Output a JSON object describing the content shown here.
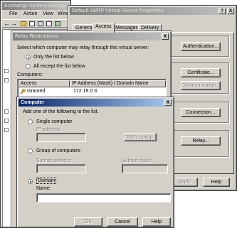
{
  "mmc": {
    "title": "Exchange System Manage",
    "menu": [
      "File",
      "Action",
      "View",
      "Wind"
    ]
  },
  "smtp": {
    "title": "Default SMTP Virtual Server Properties",
    "help_btn": "?",
    "close_btn": "X",
    "tabs": [
      "General",
      "Access",
      "Messages",
      "Delivery"
    ],
    "buttons": {
      "authentication": "Authentication...",
      "certificate": "Certificate...",
      "communication": "Communication...",
      "connection": "Connection...",
      "relay": "Relay...",
      "apply": "Apply",
      "help": "Help"
    }
  },
  "relay": {
    "title": "Relay Restrictions",
    "close_btn": "X",
    "prompt": "Select which computer may relay through this virtual server:",
    "radio_only": "Only the list below",
    "radio_all_except": "All except the list below",
    "computers_label": "Computers:",
    "col_access": "Access",
    "col_ip": "IP Address (Mask) / Domain Name",
    "rows": [
      {
        "access": "Granted",
        "ip": "172.16.0.3"
      }
    ]
  },
  "computer": {
    "title": "Computer",
    "close_btn": "X",
    "prompt": "Add one of the following to the list.",
    "single_label": "Single computer",
    "ip_label": "IP address:",
    "dns_btn": "DNS Lookup...",
    "group_label": "Group of computers",
    "subnet_addr_label": "Subnet address:",
    "subnet_mask_label": "Subnet mask:",
    "domain_label": "Domain",
    "name_label": "Name:",
    "name_value": "",
    "ok": "OK",
    "cancel": "Cancel",
    "help": "Help"
  }
}
